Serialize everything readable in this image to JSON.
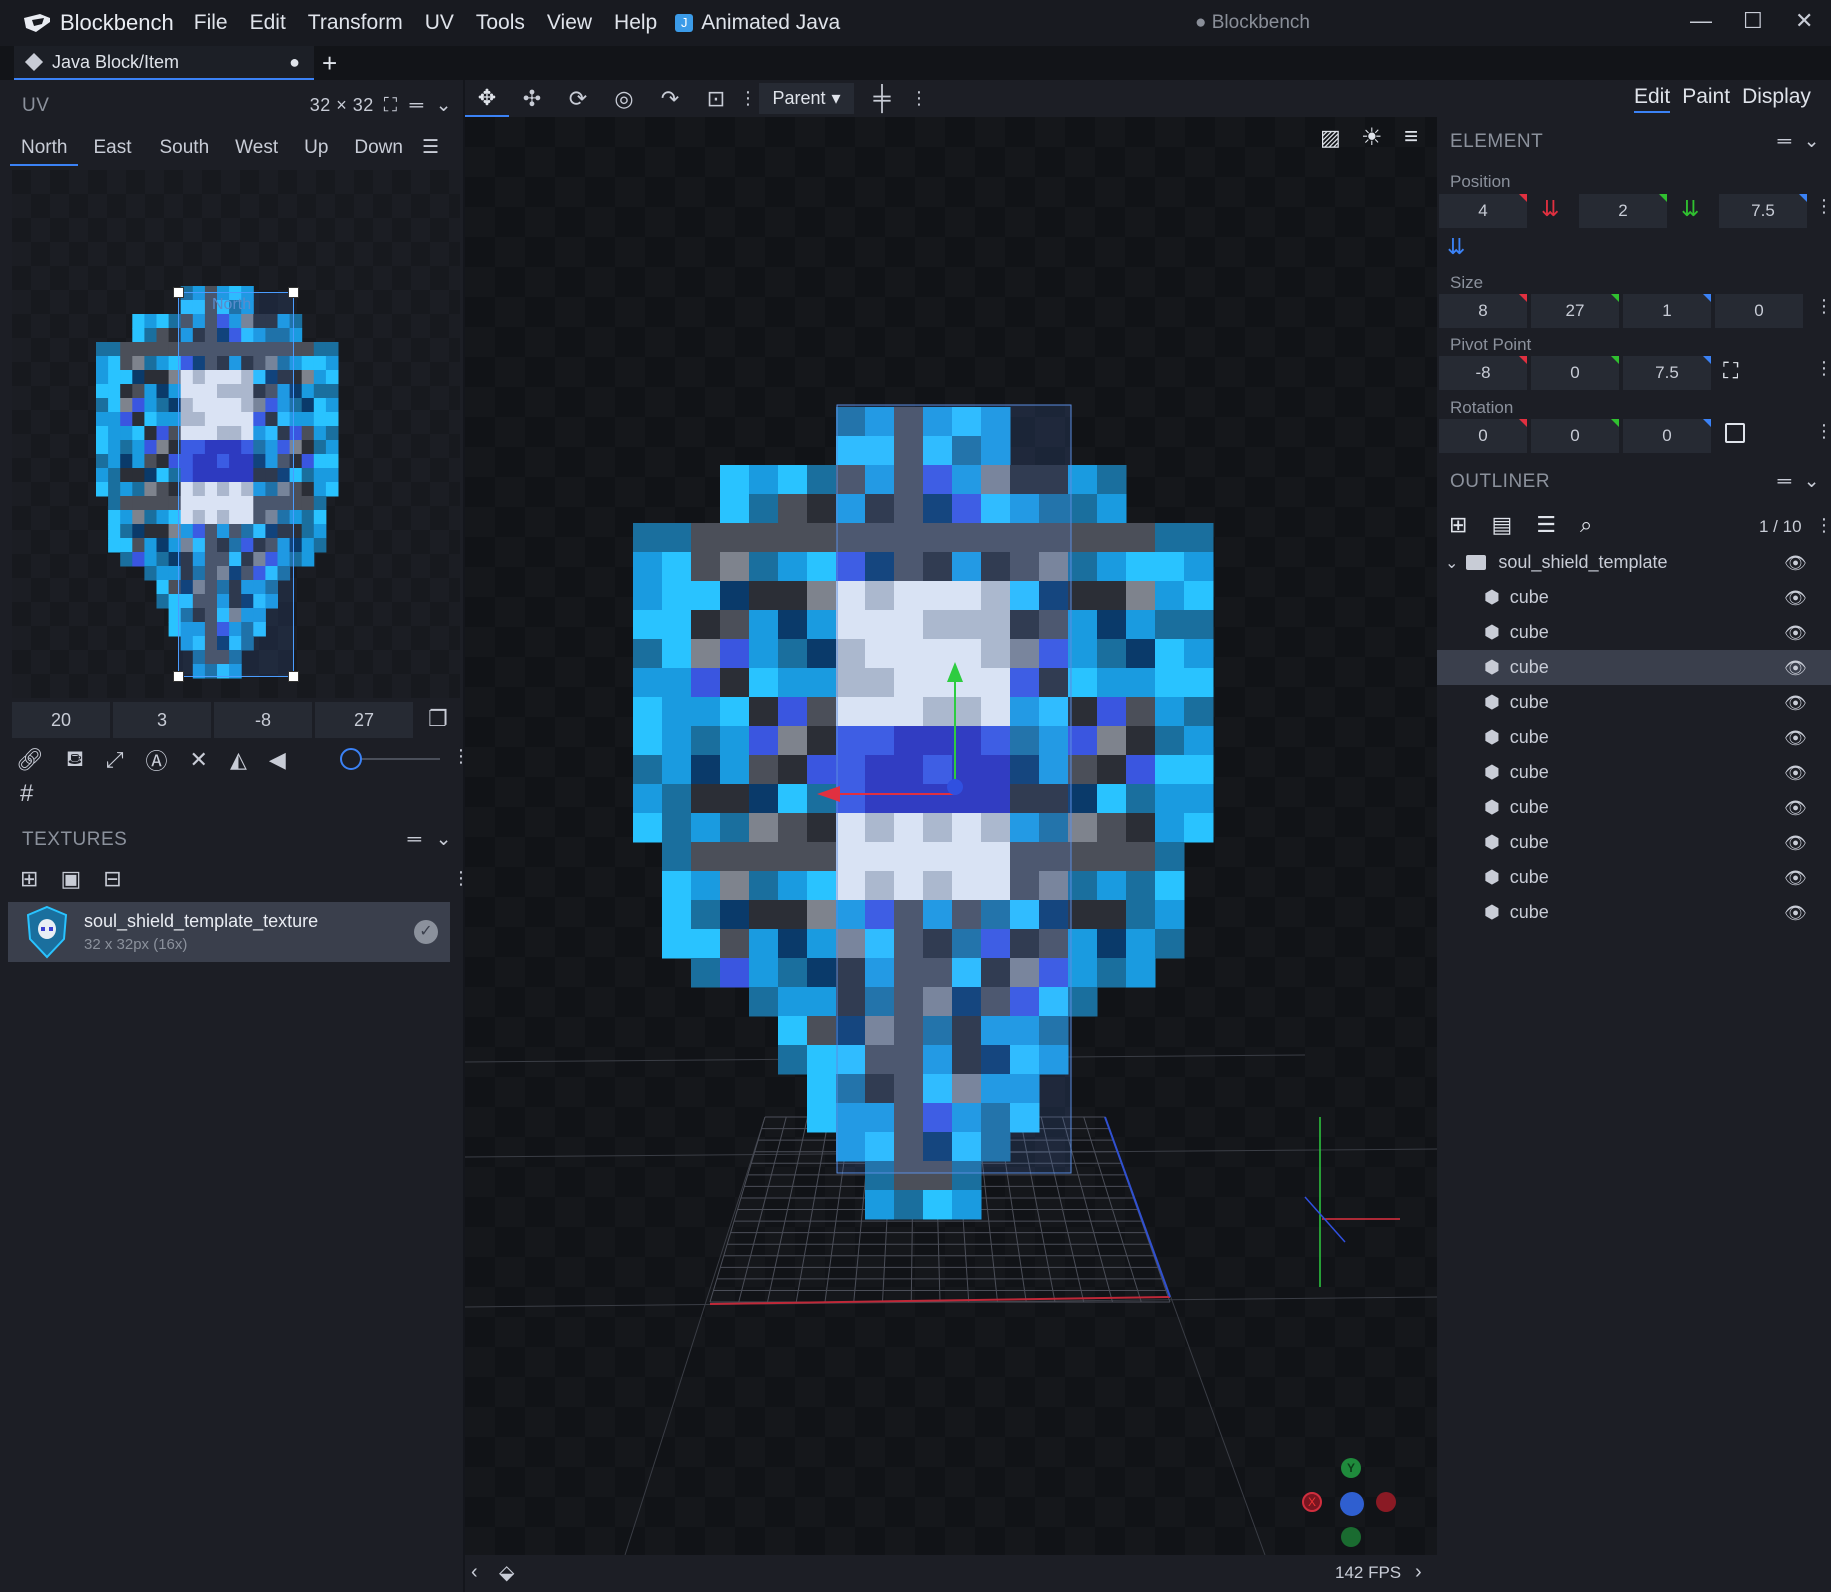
{
  "app": {
    "name": "Blockbench",
    "window_title": "● Blockbench",
    "menu": [
      "File",
      "Edit",
      "Transform",
      "UV",
      "Tools",
      "View",
      "Help"
    ],
    "plugin_menu": "Animated Java"
  },
  "tabs": [
    {
      "label": "Java Block/Item",
      "modified": "●"
    }
  ],
  "uv_panel": {
    "title": "UV",
    "resolution": "32 × 32",
    "faces": [
      "North",
      "East",
      "South",
      "West",
      "Up",
      "Down"
    ],
    "active_face": "North",
    "face_label": "North",
    "uv_values": [
      "20",
      "3",
      "-8",
      "27"
    ]
  },
  "textures_panel": {
    "title": "TEXTURES",
    "texture": {
      "name": "soul_shield_template_texture",
      "meta": "32 x 32px (16x)"
    }
  },
  "viewport": {
    "transform_space": "Parent",
    "fps": "142 FPS",
    "gizmo_labels": {
      "x": "X",
      "y": "Y"
    }
  },
  "modes": [
    "Edit",
    "Paint",
    "Display"
  ],
  "active_mode": "Edit",
  "element_panel": {
    "title": "ELEMENT",
    "position": {
      "label": "Position",
      "values": [
        "4",
        "2",
        "7.5"
      ]
    },
    "size": {
      "label": "Size",
      "values": [
        "8",
        "27",
        "1",
        "0"
      ]
    },
    "pivot": {
      "label": "Pivot Point",
      "values": [
        "-8",
        "0",
        "7.5"
      ]
    },
    "rotation": {
      "label": "Rotation",
      "values": [
        "0",
        "0",
        "0"
      ]
    }
  },
  "outliner": {
    "title": "OUTLINER",
    "count": "1 / 10",
    "group": "soul_shield_template",
    "items": [
      "cube",
      "cube",
      "cube",
      "cube",
      "cube",
      "cube",
      "cube",
      "cube",
      "cube",
      "cube"
    ],
    "selected_index": 2
  },
  "colors": {
    "accent": "#3b82f6",
    "panel": "#1c1e25",
    "selected": "#3a3f4c"
  }
}
